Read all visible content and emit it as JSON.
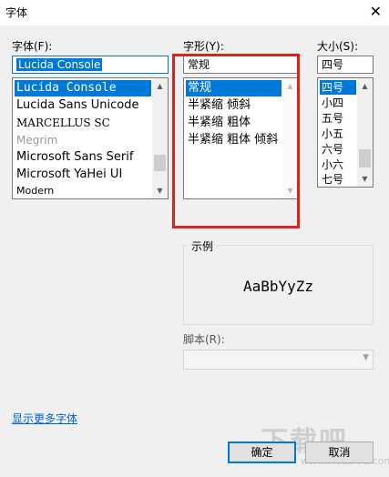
{
  "window": {
    "title": "字体",
    "close_glyph": "✕"
  },
  "font": {
    "label": "字体(F):",
    "value": "Lucida Console",
    "items": [
      "Lucida Console",
      "Lucida Sans Unicode",
      "MARCELLUS SC",
      "Megrim",
      "Microsoft Sans Serif",
      "Microsoft YaHei UI",
      "Modern"
    ],
    "selected_index": 0
  },
  "style": {
    "label": "字形(Y):",
    "value": "常规",
    "items": [
      "常规",
      "半紧缩 倾斜",
      "半紧缩 粗体",
      "半紧缩 粗体 倾斜"
    ],
    "selected_index": 0
  },
  "size": {
    "label": "大小(S):",
    "value": "四号",
    "items": [
      "四号",
      "小四",
      "五号",
      "小五",
      "六号",
      "小六",
      "七号"
    ],
    "selected_index": 0
  },
  "sample": {
    "caption": "示例",
    "text": "AaBbYyZz"
  },
  "script": {
    "label": "脚本(R):",
    "value": ""
  },
  "more_fonts_link": "显示更多字体",
  "buttons": {
    "ok": "确定",
    "cancel": "取消"
  },
  "watermark": {
    "main": "下载吧",
    "sub": "www.xiazaiba.com"
  },
  "colors": {
    "accent": "#0078d7",
    "highlight_box": "#d9231e",
    "link": "#0066cc"
  }
}
